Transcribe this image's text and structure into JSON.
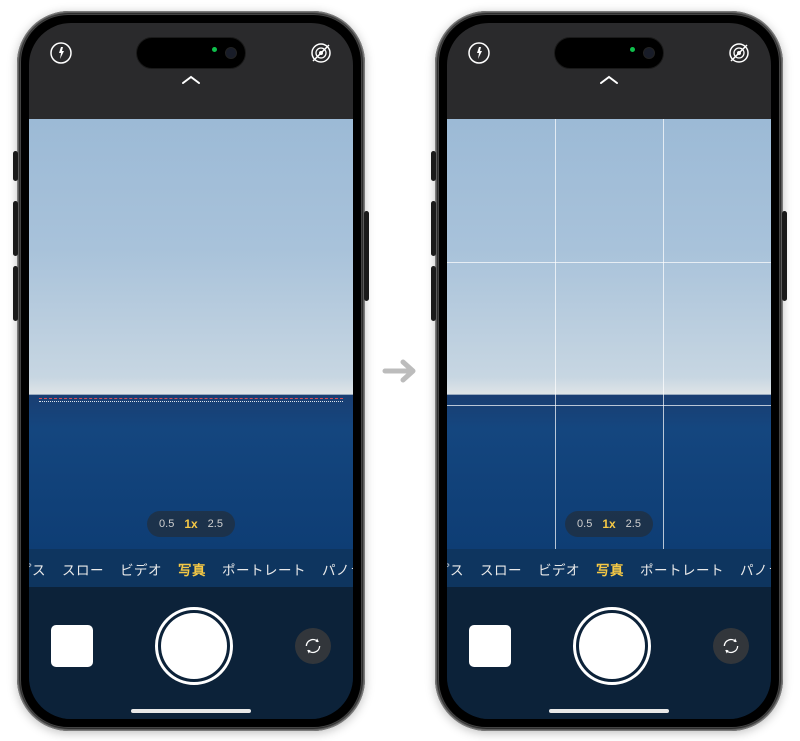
{
  "left_phone": {
    "show_grid": false,
    "show_level": true,
    "zoom": {
      "options": [
        "0.5",
        "1x",
        "2.5"
      ],
      "active_index": 1
    },
    "modes": {
      "items": [
        "ラプス",
        "スロー",
        "ビデオ",
        "写真",
        "ポートレート",
        "パノラマ"
      ],
      "active_index": 3
    },
    "icons": {
      "flash": "flash-off-icon",
      "filter": "live-off-icon",
      "expand": "chevron-up-icon",
      "flip": "camera-flip-icon"
    }
  },
  "right_phone": {
    "show_grid": true,
    "show_level": false,
    "zoom": {
      "options": [
        "0.5",
        "1x",
        "2.5"
      ],
      "active_index": 1
    },
    "modes": {
      "items": [
        "ラプス",
        "スロー",
        "ビデオ",
        "写真",
        "ポートレート",
        "パノラマ"
      ],
      "active_index": 3
    },
    "icons": {
      "flash": "flash-off-icon",
      "filter": "live-off-icon",
      "expand": "chevron-up-icon",
      "flip": "camera-flip-icon"
    }
  },
  "arrow_label": "→"
}
